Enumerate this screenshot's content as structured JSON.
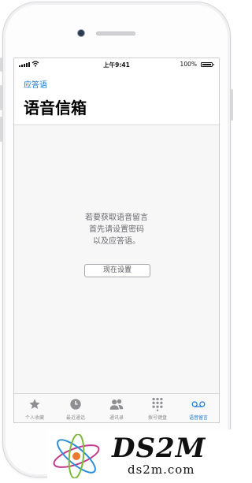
{
  "status_bar": {
    "time": "上午9:41",
    "battery": "100%"
  },
  "nav": {
    "back_label": "应答语",
    "title": "语音信箱"
  },
  "message_lines": [
    "若要获取语音留言",
    "首先请设置密码",
    "以及应答语。"
  ],
  "setup_button_label": "现在设置",
  "tabs": [
    {
      "label": "个人收藏",
      "icon": "star-icon"
    },
    {
      "label": "最近通话",
      "icon": "clock-icon"
    },
    {
      "label": "通讯录",
      "icon": "contacts-icon"
    },
    {
      "label": "拨号键盘",
      "icon": "keypad-icon"
    },
    {
      "label": "语音留言",
      "icon": "voicemail-icon",
      "active": true
    }
  ],
  "watermark": {
    "brand": "DS2M",
    "url": "ds2m.com"
  },
  "colors": {
    "accent": "#1478d4",
    "inactive_tab": "#8e8e93",
    "message_text": "#6b6b70"
  }
}
